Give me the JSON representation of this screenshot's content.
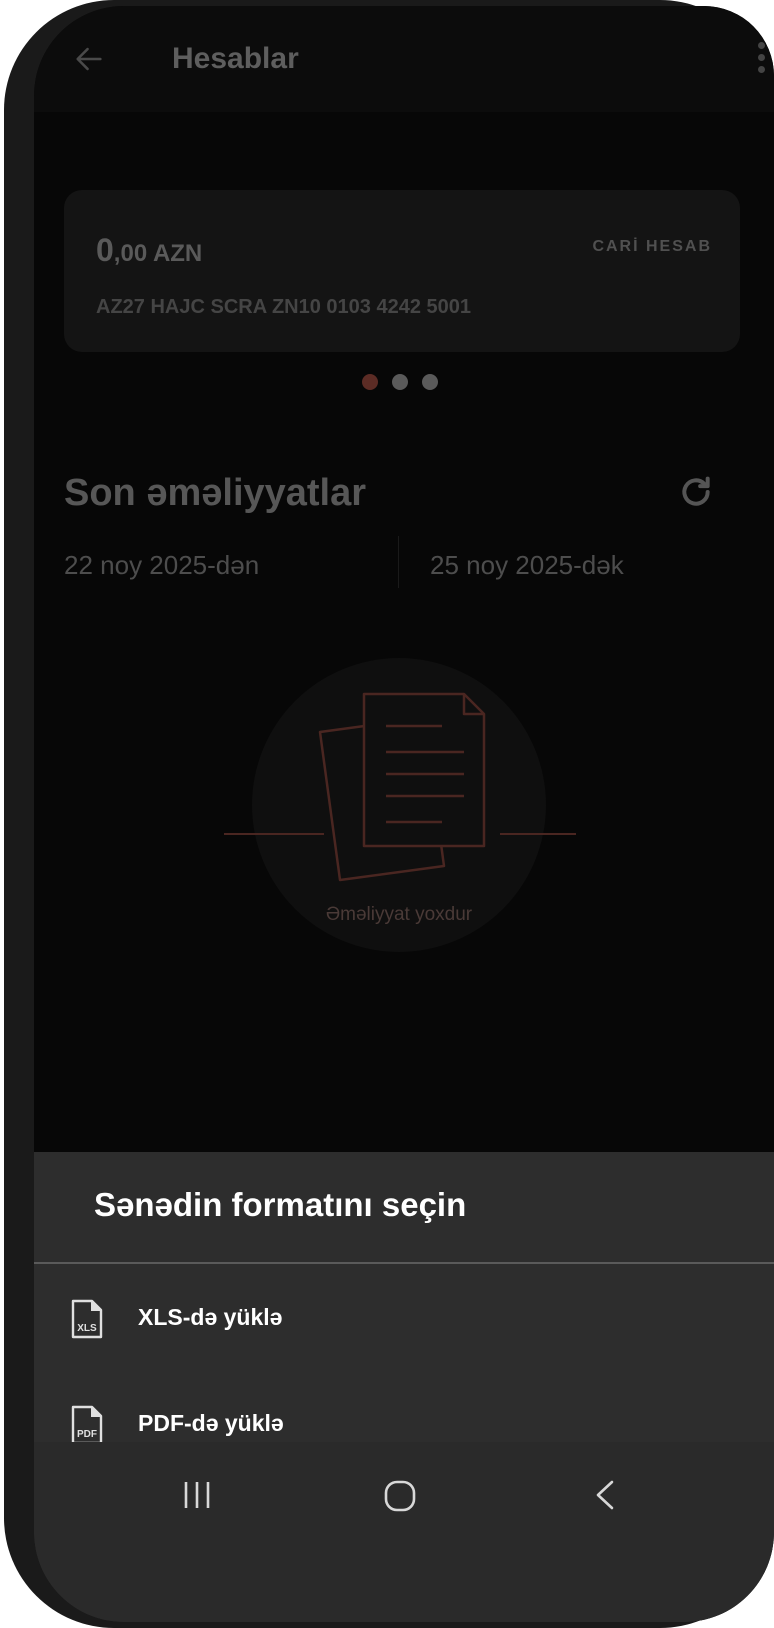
{
  "header": {
    "title": "Hesablar"
  },
  "account_card": {
    "balance_integer": "0",
    "balance_rest": ",00 AZN",
    "account_type": "CARİ HESAB",
    "iban": "AZ27 HAJC SCRA ZN10 0103 4242 5001"
  },
  "carousel": {
    "page_count": 3,
    "active_index": 0
  },
  "recent": {
    "title": "Son əməliyyatlar",
    "date_from": "22 noy 2025-dən",
    "date_to": "25 noy 2025-dək",
    "empty_text": "Əməliyyat yoxdur"
  },
  "sheet": {
    "title": "Sənədin formatını seçin",
    "items": [
      {
        "label": "XLS-də yüklə",
        "icon": "xls-file-icon",
        "icon_text": "XLS"
      },
      {
        "label": "PDF-də yüklə",
        "icon": "pdf-file-icon",
        "icon_text": "PDF"
      }
    ]
  },
  "colors": {
    "accent": "#5c2c25",
    "sheet_bg": "#2d2d2d",
    "screen_bg": "#070707"
  }
}
